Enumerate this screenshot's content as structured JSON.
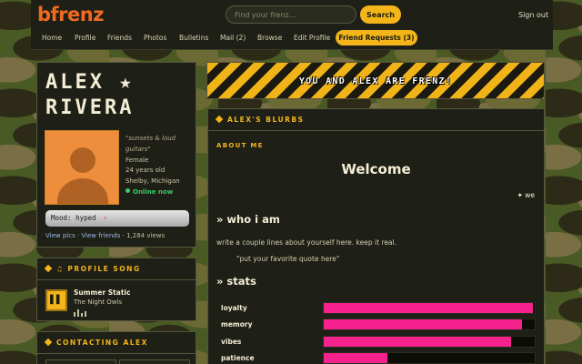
{
  "header": {
    "logo": "bfrenz",
    "search_placeholder": "Find your frenz...",
    "search_button": "Search",
    "signout": "Sign out",
    "nav": [
      "Home",
      "Profile",
      "Friends",
      "Photos",
      "Bulletins",
      "Mail (2)",
      "Browse",
      "Edit Profile"
    ],
    "nav_highlight": "Friend Requests (3)"
  },
  "profile": {
    "name_line1": "ALEX ★",
    "name_line2": "RIVERA",
    "tagline": "\"sunsets & loud guitars\"",
    "gender": "Female",
    "age": "24 years old",
    "location": "Shelby, Michigan",
    "status": "Online now",
    "mood_label": "Mood:",
    "mood_value": "hyped",
    "mood_symbol": "⚡",
    "link_pics": "View pics",
    "link_sep": " · ",
    "link_friends": "View friends",
    "views": " · 1,284 views"
  },
  "song": {
    "header": "♫ PROFILE SONG",
    "pause_symbol": "▌▌",
    "title": "Summer Static",
    "artist": "The Night Owls"
  },
  "contact": {
    "header": "CONTACTING ALEX"
  },
  "banner": {
    "text": "YOU AND ALEX ARE FRENZ!"
  },
  "blurbs": {
    "header": "ALEX'S BLURBS",
    "about_label": "ABOUT ME",
    "welcome": "Welcome",
    "marquee": "✦ we",
    "who_heading": "» who i am",
    "who_text": "write a couple lines about yourself here. keep it real.",
    "quote": "\"put your favorite quote here\"",
    "stats_heading": "» stats",
    "stats": [
      {
        "label": "loyalty",
        "value": 0.99
      },
      {
        "label": "memory",
        "value": 0.94
      },
      {
        "label": "vibes",
        "value": 0.89
      },
      {
        "label": "patience",
        "value": 0.3
      }
    ]
  },
  "colors": {
    "accent": "#f3b519",
    "logo": "#f06b21",
    "stat_bar": "#f5228d",
    "online": "#3ec96b",
    "panel": "#1e1f16"
  }
}
